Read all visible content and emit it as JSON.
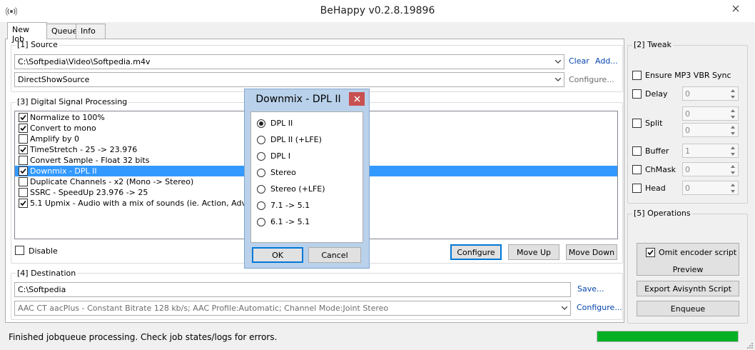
{
  "window": {
    "title": "BeHappy v0.2.8.19896"
  },
  "tabs": [
    {
      "label": "New Job",
      "active": true
    },
    {
      "label": "Queue",
      "active": false
    },
    {
      "label": "Info",
      "active": false
    }
  ],
  "source": {
    "group_label": "[1] Source",
    "file": "C:\\Softpedia\\Video\\Softpedia.m4v",
    "clear_label": "Clear",
    "add_label": "Add...",
    "decoder": "DirectShowSource",
    "configure_label": "Configure..."
  },
  "dsp": {
    "group_label": "[3] Digital Signal Processing",
    "items": [
      {
        "label": "Normalize to 100%",
        "checked": true
      },
      {
        "label": "Convert to mono",
        "checked": true
      },
      {
        "label": "Amplify by 0",
        "checked": false
      },
      {
        "label": "TimeStretch - 25 -> 23.976",
        "checked": true
      },
      {
        "label": "Convert Sample - Float 32 bits",
        "checked": false
      },
      {
        "label": "Downmix - DPL II",
        "checked": true,
        "selected": true
      },
      {
        "label": "Duplicate Channels - x2 (Mono -> Stereo)",
        "checked": false
      },
      {
        "label": "SSRC - SpeedUp 23.976 -> 25",
        "checked": false
      },
      {
        "label": "5.1 Upmix - Audio with a mix of sounds (ie. Action, Adventure)",
        "checked": true
      }
    ],
    "disable_label": "Disable",
    "configure_label": "Configure",
    "move_up_label": "Move Up",
    "move_down_label": "Move Down"
  },
  "destination": {
    "group_label": "[4] Destination",
    "path": "C:\\Softpedia",
    "save_label": "Save...",
    "encoder": "AAC CT aacPlus - Constant Bitrate 128 kb/s; AAC Profile:Automatic; Channel Mode:Joint Stereo",
    "configure_label": "Configure..."
  },
  "tweak": {
    "group_label": "[2] Tweak",
    "mp3_vbr_label": "Ensure MP3 VBR Sync",
    "delay_label": "Delay",
    "delay_value": "0",
    "split_label": "Split",
    "split_value_1": "0",
    "split_value_2": "0",
    "buffer_label": "Buffer",
    "buffer_value": "1",
    "chmask_label": "ChMask",
    "chmask_value": "0",
    "head_label": "Head",
    "head_value": "0"
  },
  "operations": {
    "group_label": "[5] Operations",
    "omit_label": "Omit encoder script",
    "preview_label": "Preview",
    "export_label": "Export Avisynth Script",
    "enqueue_label": "Enqueue"
  },
  "status": {
    "text": "Finished jobqueue processing. Check job states/logs for errors.",
    "progress": 1.0
  },
  "dialog": {
    "title": "Downmix - DPL II",
    "options": [
      {
        "label": "DPL II",
        "selected": true
      },
      {
        "label": "DPL II (+LFE)",
        "selected": false
      },
      {
        "label": "DPL I",
        "selected": false
      },
      {
        "label": "Stereo",
        "selected": false
      },
      {
        "label": "Stereo (+LFE)",
        "selected": false
      },
      {
        "label": "7.1 -> 5.1",
        "selected": false
      },
      {
        "label": "6.1 -> 5.1",
        "selected": false
      }
    ],
    "ok_label": "OK",
    "cancel_label": "Cancel"
  },
  "colors": {
    "selection": "#3399ff",
    "progress": "#06b025",
    "link": "#0645ad",
    "dialog_frame": "#b9d1ea",
    "dialog_close": "#c75050"
  }
}
